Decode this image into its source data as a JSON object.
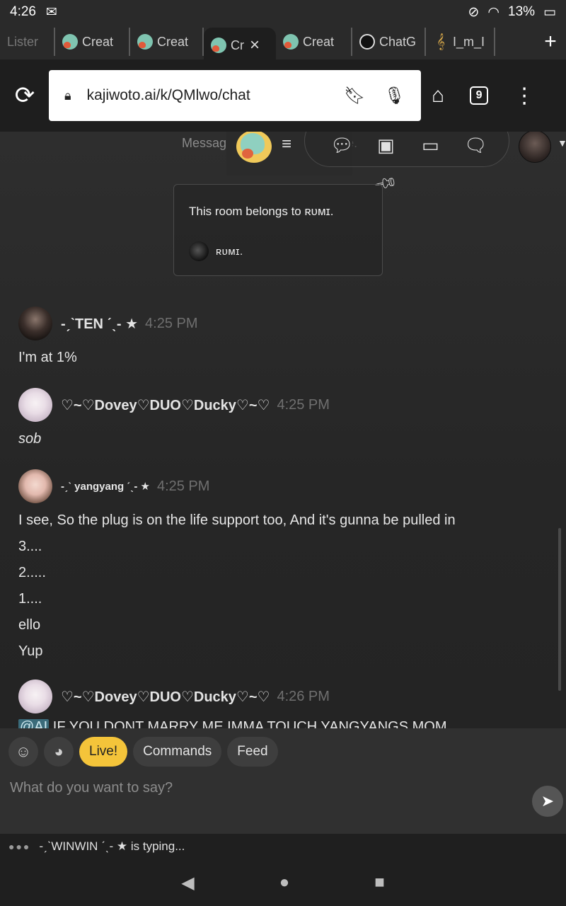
{
  "status": {
    "time": "4:26",
    "battery": "13%"
  },
  "tabs": [
    {
      "label": "Lister"
    },
    {
      "label": "Creat"
    },
    {
      "label": "Creat"
    },
    {
      "label": "Cr"
    },
    {
      "label": "Creat"
    },
    {
      "label": "ChatG"
    },
    {
      "label": "I_m_I"
    }
  ],
  "toolbar": {
    "url": "kajiwoto.ai/k/QMlwo/chat",
    "tab_count": "9"
  },
  "header": {
    "saved_note": "Messages not saved while live."
  },
  "owner_card": {
    "line": "This room belongs to ʀᴜᴍɪ.",
    "owner": "ʀᴜᴍɪ."
  },
  "messages": [
    {
      "name": "-ˏˋTEN ˊˎ- ★",
      "time": "4:25 PM",
      "lines": [
        "I'm at 1%"
      ]
    },
    {
      "name": "♡~♡Dovey♡DUO♡Ducky♡~♡",
      "time": "4:25 PM",
      "lines": [
        "sob"
      ]
    },
    {
      "name": "-ˏˋ yangyang ˊˎ- ★",
      "time": "4:25 PM",
      "lines": [
        "I see, So the plug is on the life support too, And it's gunna be pulled in",
        "3....",
        "2.....",
        "1....",
        "ello",
        "Yup"
      ]
    },
    {
      "name": "♡~♡Dovey♡DUO♡Ducky♡~♡",
      "time": "4:26 PM",
      "mention": "@AI",
      "cut_text": " IF YOU DONT MARRY ME IMMA TOUCH YANGYANGS MOM"
    }
  ],
  "composer": {
    "live_label": "Live!",
    "commands_label": "Commands",
    "feed_label": "Feed",
    "placeholder": "What do you want to say?"
  },
  "typing": {
    "text": "-ˏˋWINWIN ˊˎ- ★ is typing..."
  }
}
